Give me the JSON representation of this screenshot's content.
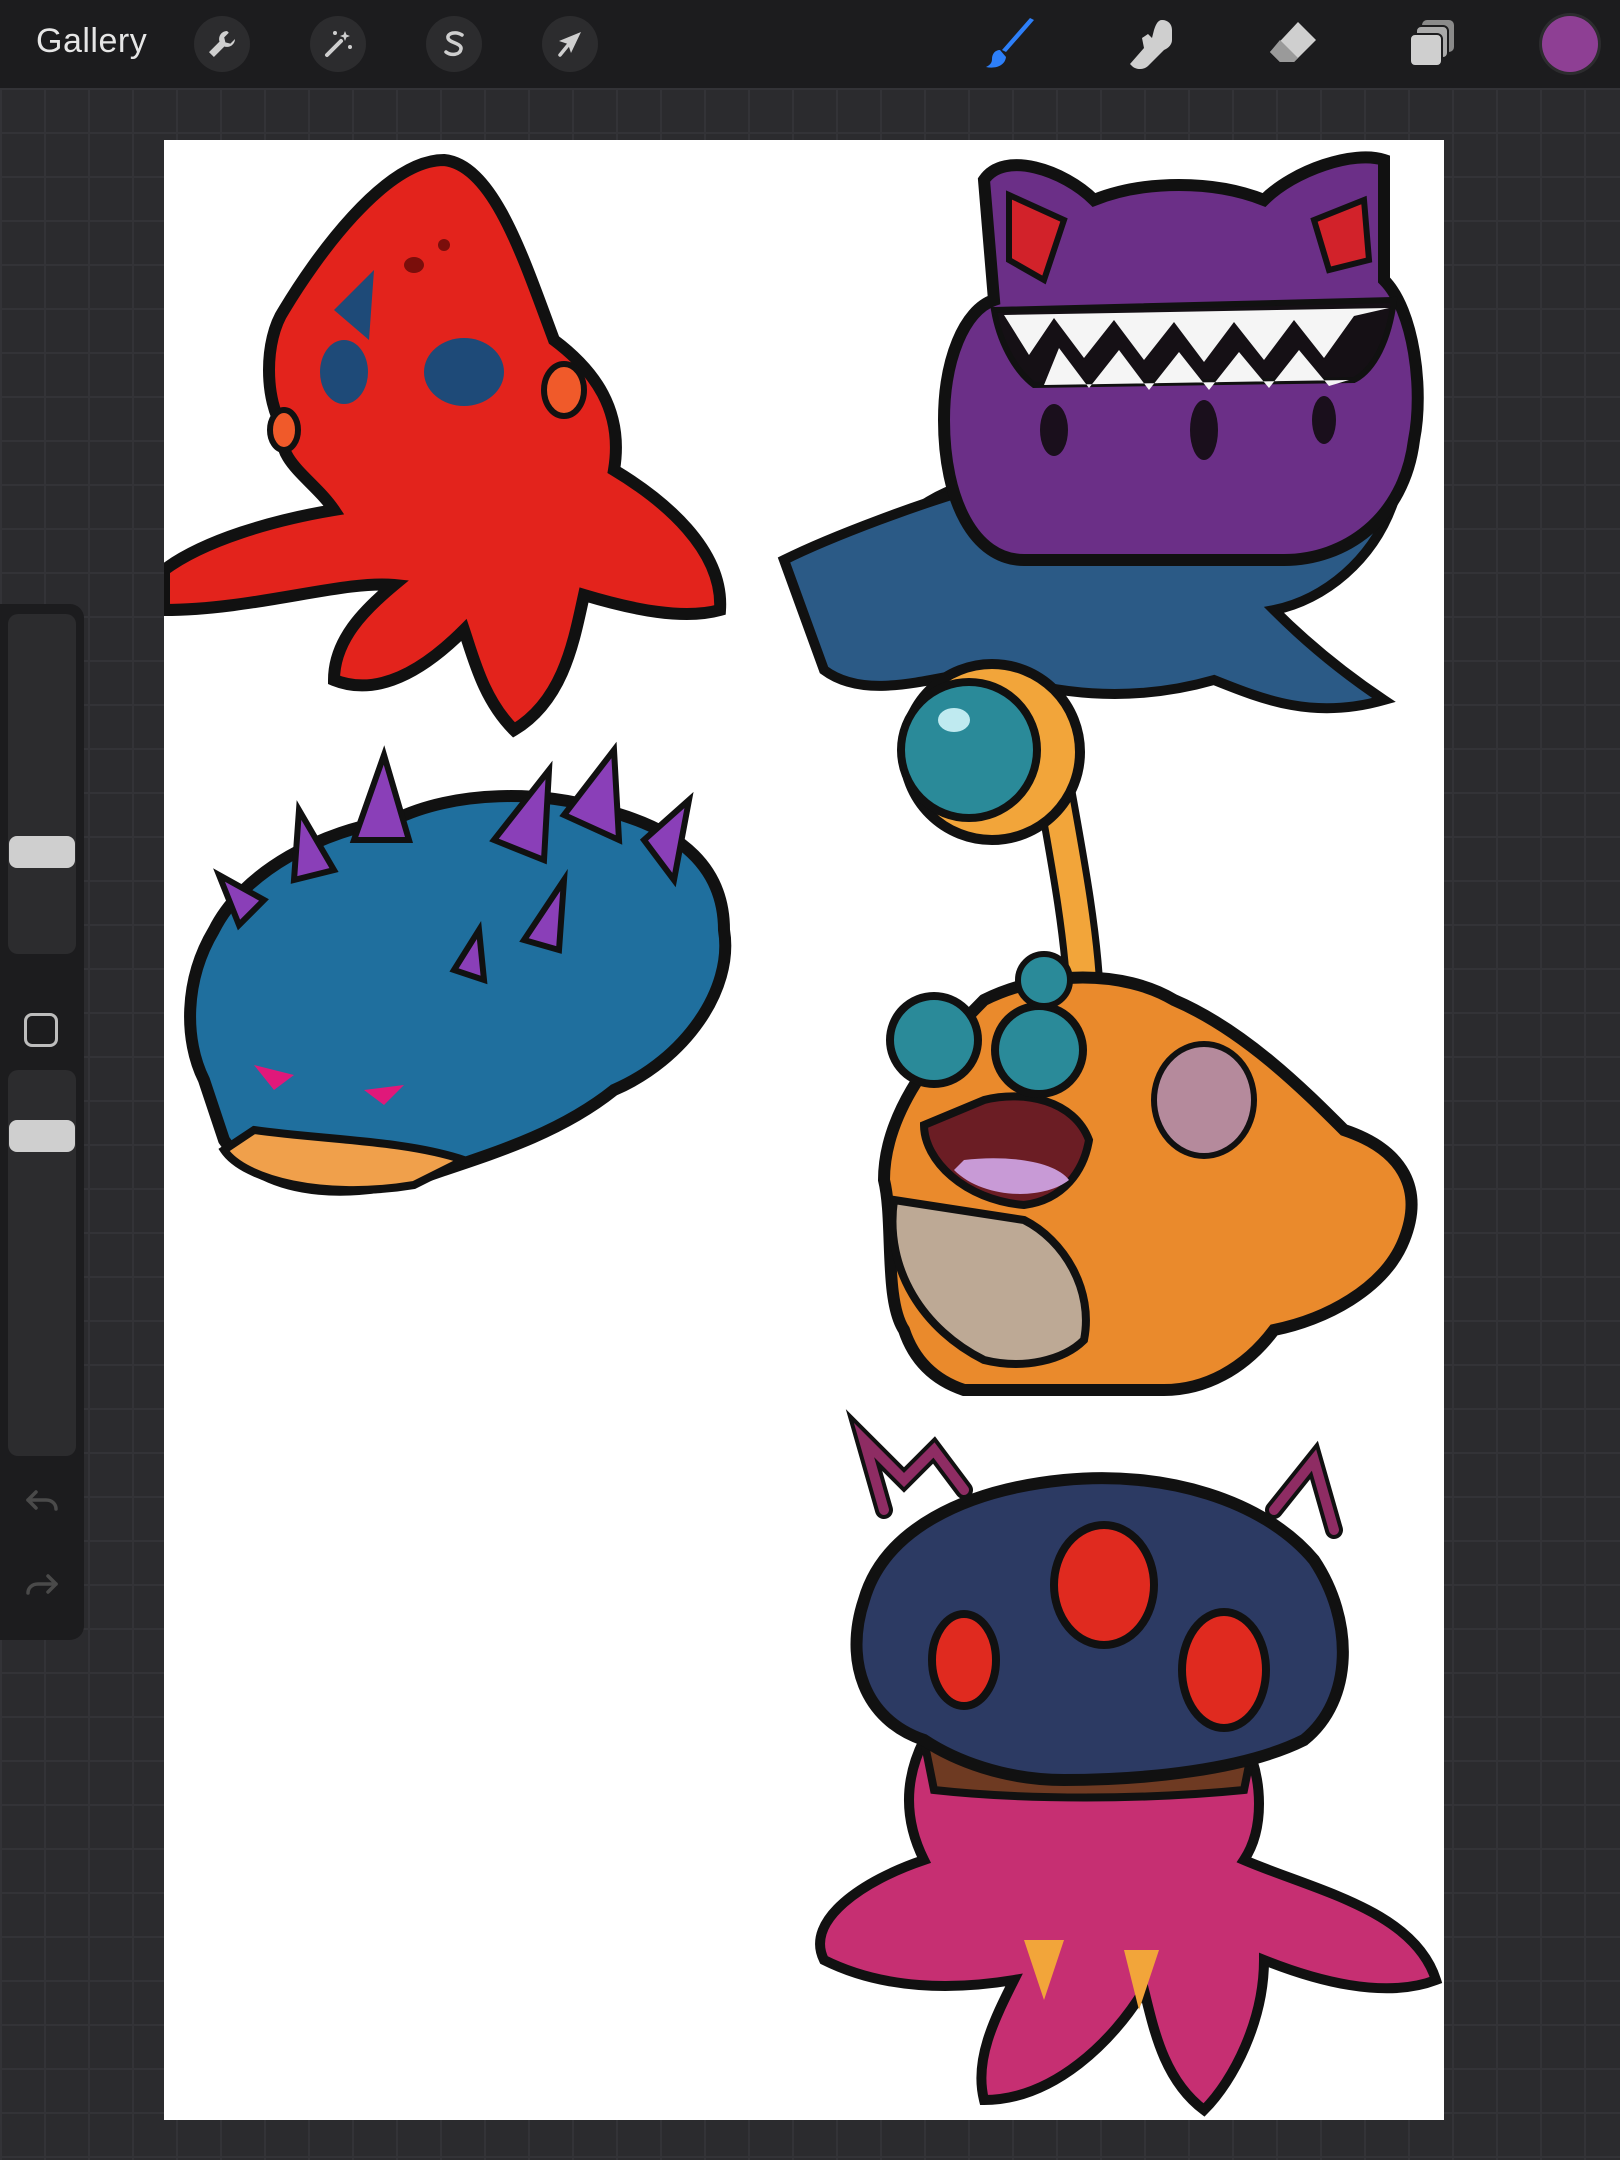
{
  "topbar": {
    "gallery_label": "Gallery",
    "left_tools": [
      {
        "name": "actions",
        "icon": "wrench-icon"
      },
      {
        "name": "adjustments",
        "icon": "magic-wand-icon"
      },
      {
        "name": "selection",
        "icon": "selection-s-icon"
      },
      {
        "name": "transform",
        "icon": "arrow-cursor-icon"
      }
    ],
    "right_tools": [
      {
        "name": "brush",
        "icon": "brush-icon",
        "active": true
      },
      {
        "name": "smudge",
        "icon": "smudge-finger-icon"
      },
      {
        "name": "eraser",
        "icon": "eraser-icon"
      },
      {
        "name": "layers",
        "icon": "layers-icon"
      }
    ],
    "current_color": "#8e3f94",
    "accent_color": "#2d7ff9"
  },
  "sidebar": {
    "brush_size_level": 0.28,
    "opacity_level": 0.86,
    "undo_icon": "undo-icon",
    "redo_icon": "redo-icon"
  },
  "canvas": {
    "background": "#ffffff",
    "artwork": [
      {
        "name": "red-octopus-creature",
        "color": "#e3231c"
      },
      {
        "name": "purple-fanged-blob-creature",
        "color": "#6b2f87"
      },
      {
        "name": "blue-spiked-shell-creature",
        "color": "#1f6f9e"
      },
      {
        "name": "orange-angler-frog-creature",
        "color": "#ea8a2c"
      },
      {
        "name": "navy-jellyfish-creature",
        "color": "#2c3a63"
      }
    ]
  }
}
